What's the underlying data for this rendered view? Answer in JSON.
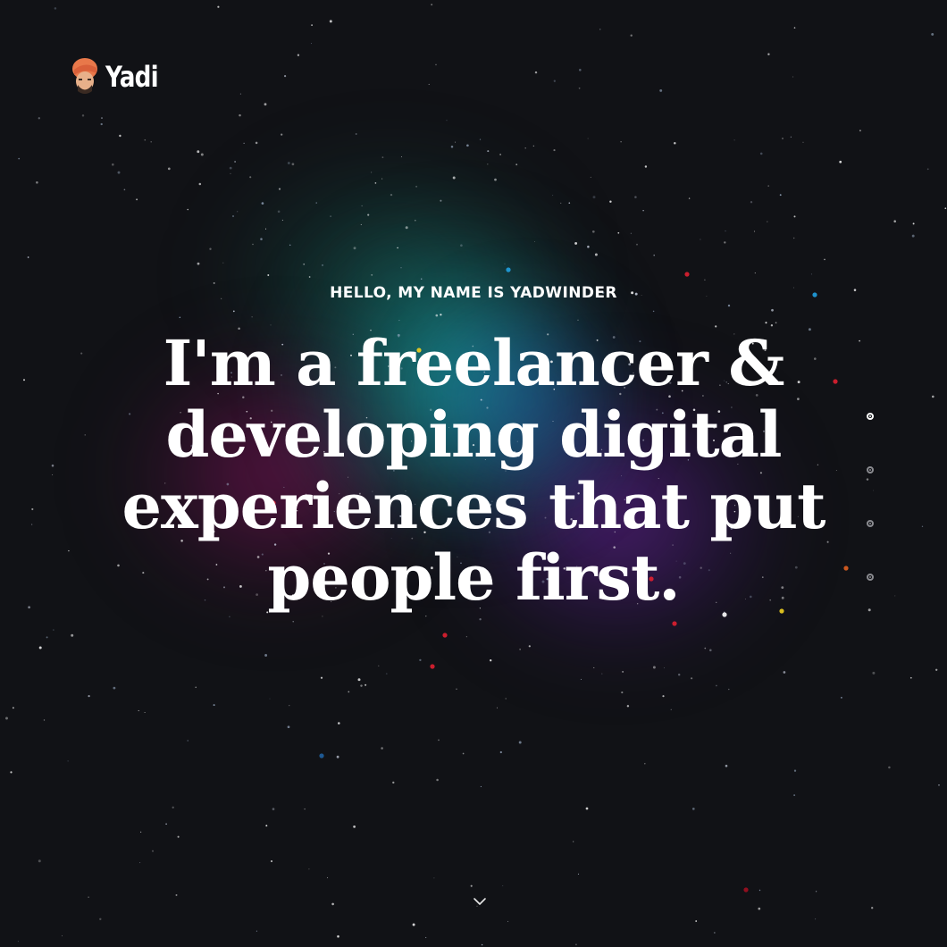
{
  "brand": {
    "name": "Yadi",
    "avatar_icon": "turban-avatar-icon"
  },
  "hero": {
    "eyebrow": "HELLO, MY NAME IS YADWINDER",
    "headline": "I'm a freelancer & developing digital experiences that put people first."
  },
  "section_dots": {
    "count": 4,
    "active_index": 0
  },
  "scroll_indicator": {
    "icon": "chevron-down-icon"
  },
  "colors": {
    "background": "#111216",
    "text": "#ffffff",
    "dot_inactive": "#8a8b90",
    "glow_teal": "#19bebe",
    "glow_magenta": "#a0146e",
    "glow_violet": "#7828b4"
  }
}
